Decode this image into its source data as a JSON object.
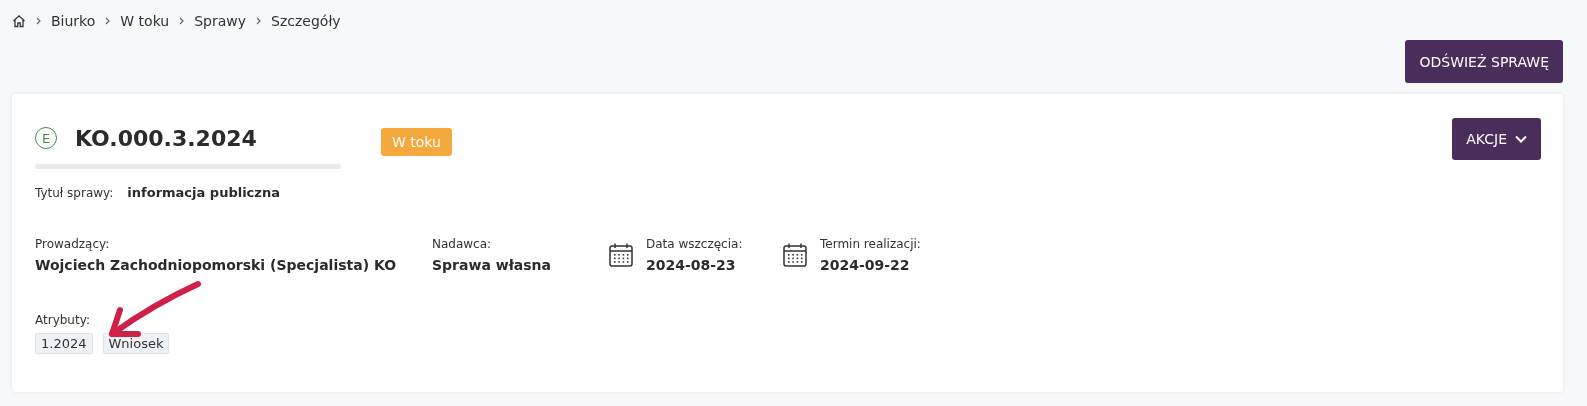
{
  "breadcrumb": [
    "Biurko",
    "W toku",
    "Sprawy",
    "Szczegóły"
  ],
  "refresh_button": "ODŚWIEŻ SPRAWĘ",
  "case": {
    "badge_letter": "E",
    "number": "KO.000.3.2024",
    "status": "W toku",
    "actions_button": "AKCJE",
    "title_label": "Tytuł sprawy:",
    "title_value": "informacja publiczna",
    "fields": [
      {
        "kind": "plain",
        "label": "Prowadzący:",
        "value": "Wojciech Zachodniopomorski (Specjalista) KO"
      },
      {
        "kind": "plain",
        "label": "Nadawca:",
        "value": "Sprawa własna"
      },
      {
        "kind": "date",
        "label": "Data wszczęcia:",
        "value": "2024-08-23"
      },
      {
        "kind": "date",
        "label": "Termin realizacji:",
        "value": "2024-09-22"
      }
    ],
    "attributes_label": "Atrybuty:",
    "attributes": [
      "1.2024",
      "Wniosek"
    ]
  }
}
